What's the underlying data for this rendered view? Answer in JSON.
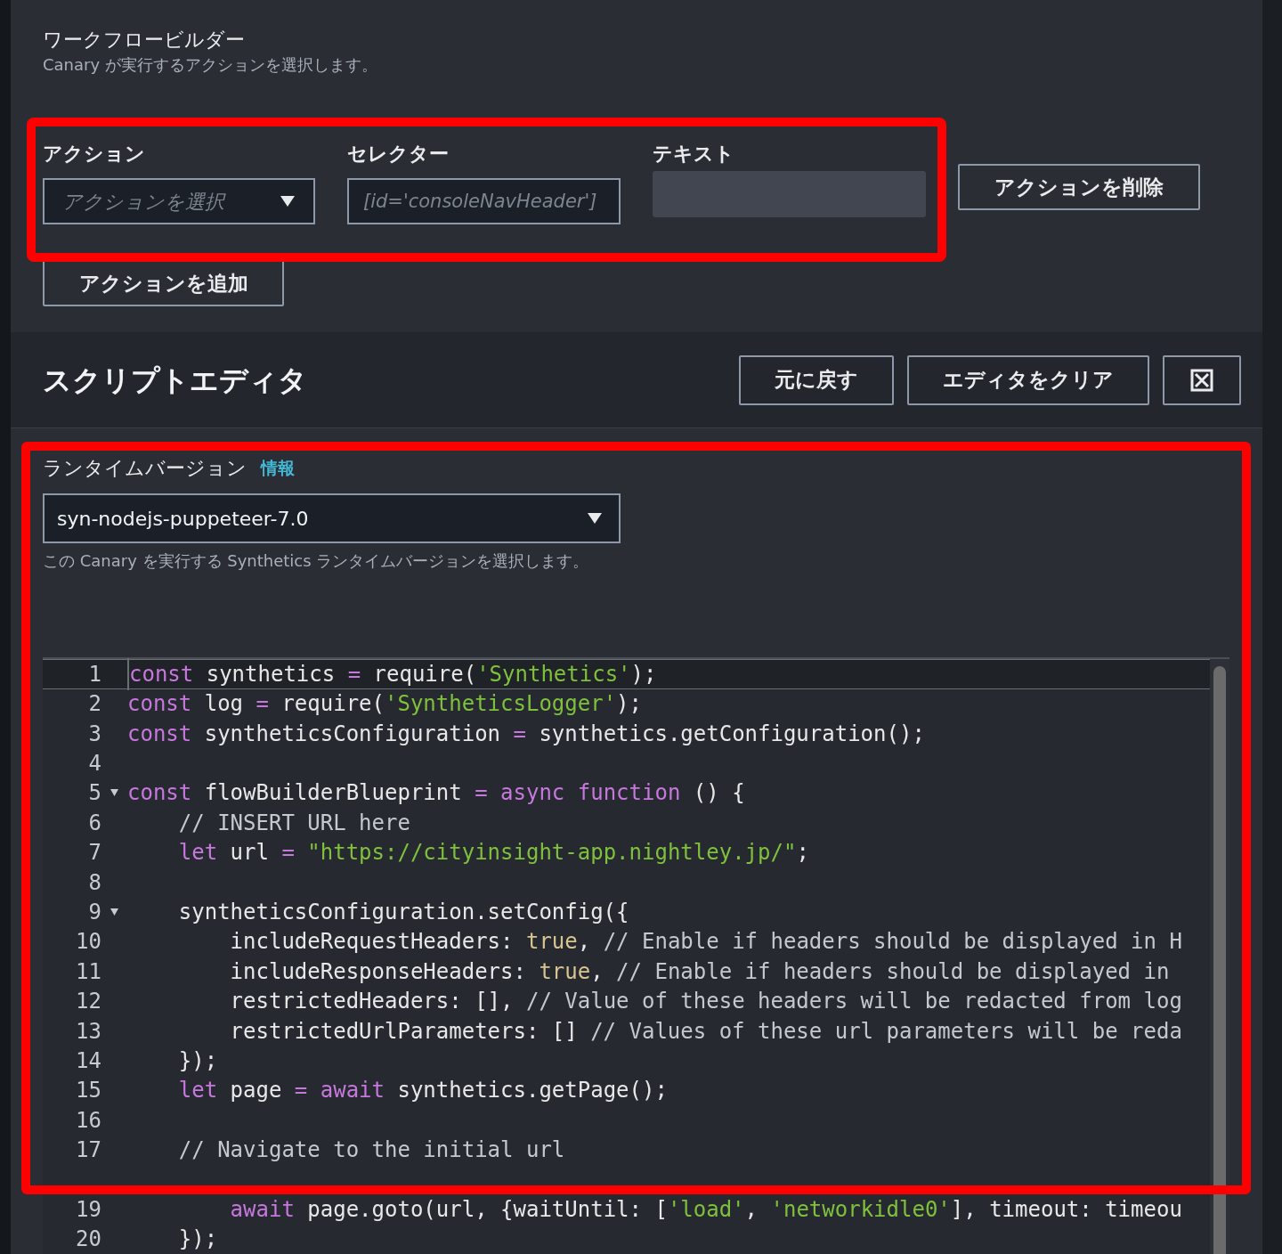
{
  "workflow": {
    "title": "ワークフロービルダー",
    "subtitle": "Canary が実行するアクションを選択します。",
    "action": {
      "label": "アクション",
      "placeholder": "アクションを選択"
    },
    "selector": {
      "label": "セレクター",
      "placeholder": "[id='consoleNavHeader']"
    },
    "text": {
      "label": "テキスト",
      "disabled": true
    },
    "delete_button": "アクションを削除",
    "add_button": "アクションを追加"
  },
  "script_editor": {
    "title": "スクリプトエディタ",
    "buttons": [
      "元に戻す",
      "エディタをクリア"
    ],
    "runtime": {
      "label": "ランタイムバージョン",
      "info_link": "情報",
      "value": "syn-nodejs-puppeteer-7.0",
      "help": "この Canary を実行する Synthetics ランタイムバージョンを選択します。"
    },
    "lines": [
      {
        "number": "1",
        "selected": true,
        "fold": false,
        "tokens": [
          {
            "kind": "keyword",
            "text": "const"
          },
          {
            "kind": "plain",
            "text": " synthetics "
          },
          {
            "kind": "operator",
            "text": "="
          },
          {
            "kind": "plain",
            "text": " require("
          },
          {
            "kind": "string",
            "text": "'Synthetics'"
          },
          {
            "kind": "plain",
            "text": ");"
          }
        ]
      },
      {
        "number": "2",
        "selected": false,
        "fold": false,
        "tokens": [
          {
            "kind": "keyword",
            "text": "const"
          },
          {
            "kind": "plain",
            "text": " log "
          },
          {
            "kind": "operator",
            "text": "="
          },
          {
            "kind": "plain",
            "text": " require("
          },
          {
            "kind": "string",
            "text": "'SyntheticsLogger'"
          },
          {
            "kind": "plain",
            "text": ");"
          }
        ]
      },
      {
        "number": "3",
        "selected": false,
        "fold": false,
        "tokens": [
          {
            "kind": "keyword",
            "text": "const"
          },
          {
            "kind": "plain",
            "text": " syntheticsConfiguration "
          },
          {
            "kind": "operator",
            "text": "="
          },
          {
            "kind": "plain",
            "text": " synthetics.getConfiguration();"
          }
        ]
      },
      {
        "number": "4",
        "selected": false,
        "fold": false
      },
      {
        "number": "5",
        "selected": false,
        "fold": true,
        "tokens": [
          {
            "kind": "keyword",
            "text": "const"
          },
          {
            "kind": "plain",
            "text": " flowBuilderBlueprint "
          },
          {
            "kind": "operator",
            "text": "="
          },
          {
            "kind": "keyword",
            "text": " async"
          },
          {
            "kind": "keyword",
            "text": " function"
          },
          {
            "kind": "plain",
            "text": " () {"
          }
        ]
      },
      {
        "number": "6",
        "selected": false,
        "fold": false,
        "tokens": [
          {
            "kind": "comment",
            "text": "    // INSERT URL here"
          }
        ]
      },
      {
        "number": "7",
        "selected": false,
        "fold": false,
        "tokens": [
          {
            "kind": "keyword",
            "text": "    let"
          },
          {
            "kind": "plain",
            "text": " url "
          },
          {
            "kind": "operator",
            "text": "="
          },
          {
            "kind": "string",
            "text": " \"https://cityinsight-app.nightley.jp/\""
          },
          {
            "kind": "plain",
            "text": ";"
          }
        ]
      },
      {
        "number": "8",
        "selected": false,
        "fold": false
      },
      {
        "number": "9",
        "selected": false,
        "fold": true,
        "tokens": [
          {
            "kind": "plain",
            "text": "    syntheticsConfiguration.setConfig({"
          }
        ]
      },
      {
        "number": "10",
        "selected": false,
        "fold": false,
        "tokens": [
          {
            "kind": "plain",
            "text": "        includeRequestHeaders: "
          },
          {
            "kind": "bool",
            "text": "true"
          },
          {
            "kind": "plain",
            "text": ", "
          },
          {
            "kind": "comment",
            "text": "// Enable if headers should be displayed in H"
          }
        ]
      },
      {
        "number": "11",
        "selected": false,
        "fold": false,
        "tokens": [
          {
            "kind": "plain",
            "text": "        includeResponseHeaders: "
          },
          {
            "kind": "bool",
            "text": "true"
          },
          {
            "kind": "plain",
            "text": ", "
          },
          {
            "kind": "comment",
            "text": "// Enable if headers should be displayed in"
          }
        ]
      },
      {
        "number": "12",
        "selected": false,
        "fold": false,
        "tokens": [
          {
            "kind": "plain",
            "text": "        restrictedHeaders: [], "
          },
          {
            "kind": "comment",
            "text": "// Value of these headers will be redacted from log"
          }
        ]
      },
      {
        "number": "13",
        "selected": false,
        "fold": false,
        "tokens": [
          {
            "kind": "plain",
            "text": "        restrictedUrlParameters: [] "
          },
          {
            "kind": "comment",
            "text": "// Values of these url parameters will be reda"
          }
        ]
      },
      {
        "number": "14",
        "selected": false,
        "fold": false,
        "tokens": [
          {
            "kind": "plain",
            "text": "    });"
          }
        ]
      },
      {
        "number": "15",
        "selected": false,
        "fold": false,
        "tokens": [
          {
            "kind": "keyword",
            "text": "    let"
          },
          {
            "kind": "plain",
            "text": " page "
          },
          {
            "kind": "operator",
            "text": "="
          },
          {
            "kind": "keyword",
            "text": " await"
          },
          {
            "kind": "plain",
            "text": " synthetics.getPage();"
          }
        ]
      },
      {
        "number": "16",
        "selected": false,
        "fold": false
      },
      {
        "number": "17",
        "selected": false,
        "fold": false,
        "tokens": [
          {
            "kind": "comment",
            "text": "    // Navigate to the initial url"
          }
        ]
      },
      {
        "selected": false,
        "fold": false
      },
      {
        "number": "19",
        "selected": false,
        "fold": false,
        "tokens": [
          {
            "kind": "keyword",
            "text": "        await"
          },
          {
            "kind": "plain",
            "text": " page.goto(url, {waitUntil: ["
          },
          {
            "kind": "string",
            "text": "'load'"
          },
          {
            "kind": "plain",
            "text": ", "
          },
          {
            "kind": "string",
            "text": "'networkidle0'"
          },
          {
            "kind": "plain",
            "text": "], timeout: timeou"
          }
        ]
      },
      {
        "number": "20",
        "selected": false,
        "fold": false,
        "tokens": [
          {
            "kind": "plain",
            "text": "    });"
          }
        ]
      }
    ]
  }
}
